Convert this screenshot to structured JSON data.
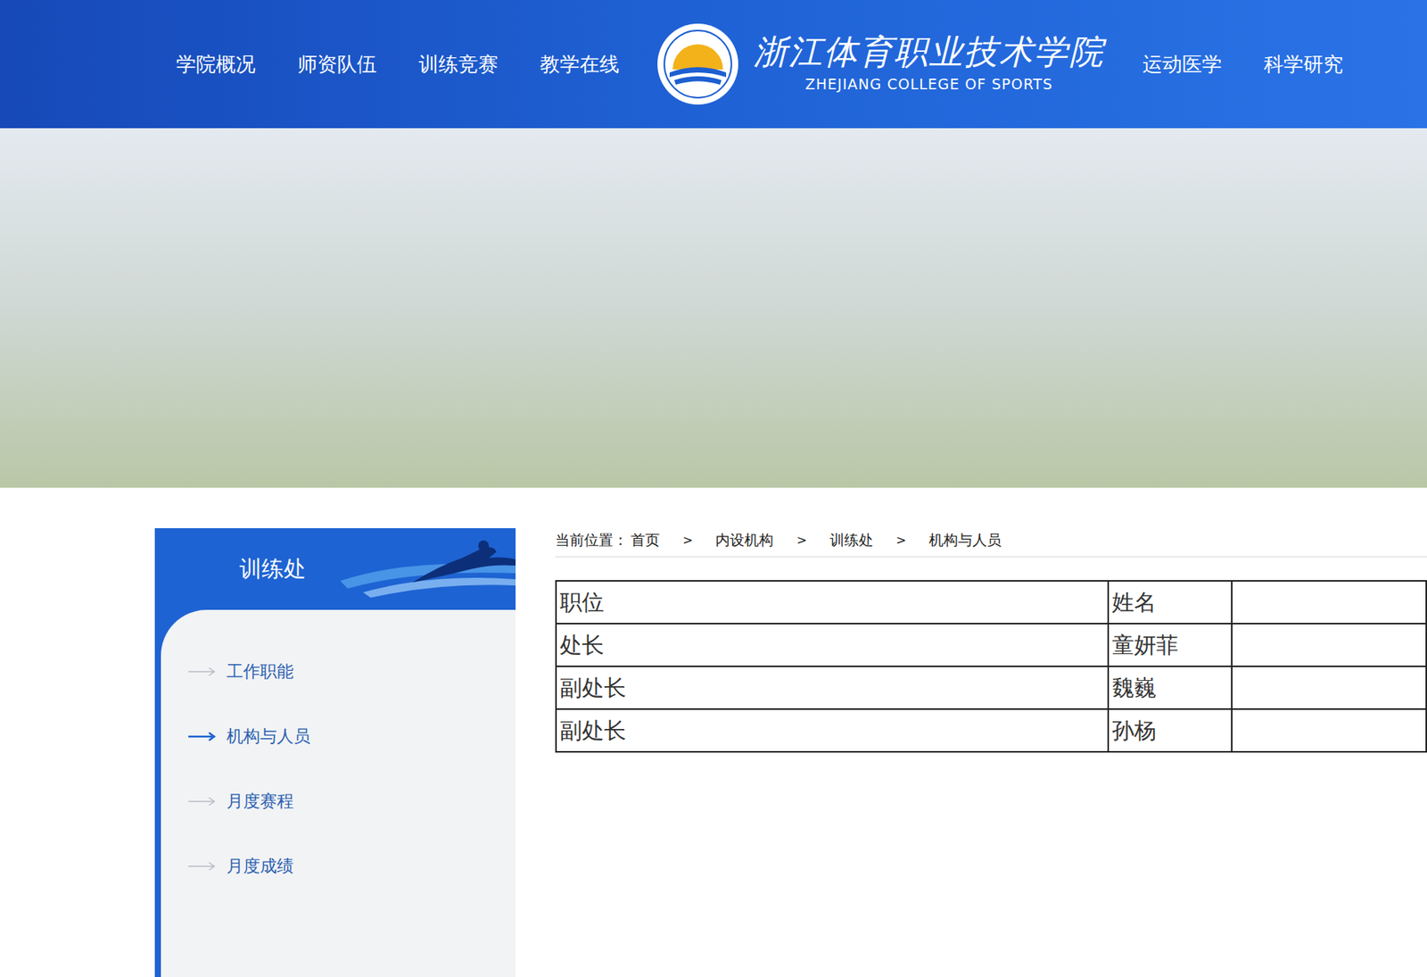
{
  "header": {
    "nav_left": [
      "学院概况",
      "师资队伍",
      "训练竞赛",
      "教学在线"
    ],
    "logo": {
      "title": "浙江体育职业技术学院",
      "subtitle": "ZHEJIANG COLLEGE OF SPORTS"
    },
    "nav_right": [
      "运动医学",
      "科学研究"
    ]
  },
  "sidebar": {
    "title": "训练处",
    "items": [
      {
        "label": "工作职能",
        "selected": false
      },
      {
        "label": "机构与人员",
        "selected": true
      },
      {
        "label": "月度赛程",
        "selected": false
      },
      {
        "label": "月度成绩",
        "selected": false
      }
    ]
  },
  "breadcrumb": {
    "label": "当前位置：",
    "separator": ">",
    "items": [
      "首页",
      "内设机构",
      "训练处",
      "机构与人员"
    ]
  },
  "table": {
    "columns": [
      "职位",
      "姓名"
    ],
    "rows": [
      [
        "处长",
        "童妍菲"
      ],
      [
        "副处长",
        "魏巍"
      ],
      [
        "副处长",
        "孙杨"
      ]
    ]
  }
}
